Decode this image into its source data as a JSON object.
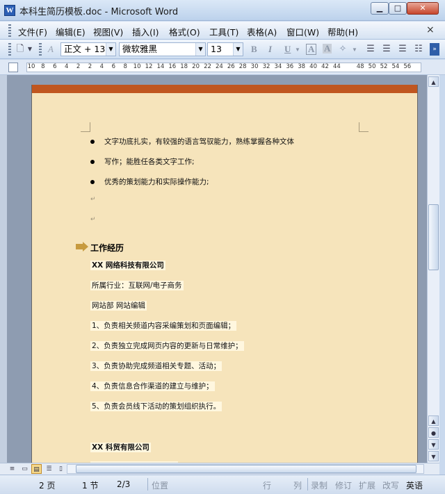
{
  "window": {
    "title": "本科生简历模板.doc - Microsoft Word",
    "icon_letter": "W",
    "minimize_icon": "minimize-icon",
    "maximize_icon": "maximize-icon",
    "close_icon": "close-icon"
  },
  "menubar": {
    "items": [
      "文件(F)",
      "编辑(E)",
      "视图(V)",
      "插入(I)",
      "格式(O)",
      "工具(T)",
      "表格(A)",
      "窗口(W)",
      "帮助(H)"
    ],
    "close_label": "×"
  },
  "toolbar": {
    "style_value": "正文 + 13",
    "font_value": "微软雅黑",
    "size_value": "13",
    "bold_label": "B",
    "italic_label": "I",
    "underline_label": "U",
    "char_border_label": "A",
    "char_shade_label": "A"
  },
  "ruler": {
    "numbers": [
      "10",
      "8",
      "6",
      "4",
      "2",
      "2",
      "4",
      "6",
      "8",
      "10",
      "12",
      "14",
      "16",
      "18",
      "20",
      "22",
      "24",
      "26",
      "28",
      "30",
      "32",
      "34",
      "36",
      "38",
      "40",
      "42",
      "44",
      "48",
      "50",
      "52",
      "54",
      "56"
    ]
  },
  "document": {
    "bullets": [
      "文字功底扎实，有较强的语言驾驭能力，熟练掌握各种文体",
      "写作；能胜任各类文字工作;",
      "优秀的策划能力和实际操作能力;"
    ],
    "para_mark": "↵",
    "section_title": "工作经历",
    "company1": "XX 网络科技有限公司",
    "industry": "所属行业：互联网/电子商务",
    "department": "网站部  网站编辑",
    "duties": [
      "1、负责相关频道内容采编策划和页面编辑；",
      "2、负责独立完成网页内容的更新与日常维护；",
      "3、负责协助完成频道相关专题、活动；",
      "4、负责信息合作渠道的建立与维护；",
      "5、负责会员线下活动的策划组织执行。"
    ],
    "company2": "XX 科贸有限公司"
  },
  "statusbar": {
    "page": "2 页",
    "section": "1 节",
    "page_of": "2/3",
    "position": "位置",
    "line": "行",
    "column": "列",
    "record": "录制",
    "revise": "修订",
    "extend": "扩展",
    "overtype": "改写",
    "language": "英语"
  },
  "colors": {
    "page_bg": "#f6e4bb",
    "band": "#c0561f",
    "arrow": "#c79a3e"
  }
}
